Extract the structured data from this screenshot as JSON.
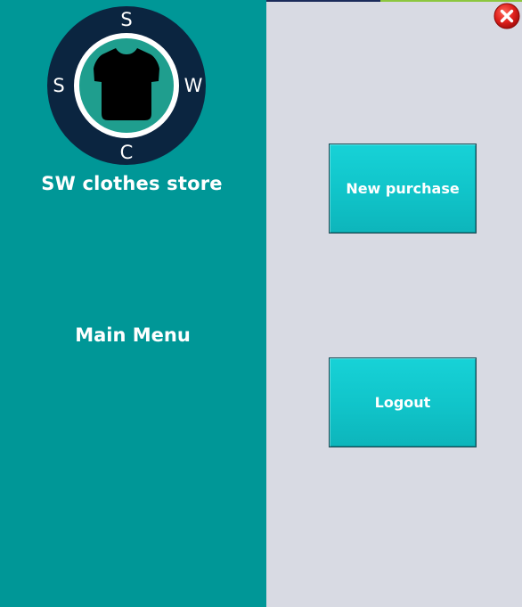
{
  "store": {
    "logo_letters": {
      "top": "S",
      "left": "S",
      "right": "W",
      "bottom": "C"
    },
    "name": "SW clothes store"
  },
  "menu": {
    "title": "Main Menu"
  },
  "buttons": {
    "new_purchase": "New purchase",
    "logout": "Logout"
  },
  "window": {
    "close_icon": "close-icon"
  },
  "colors": {
    "sidebar": "#009797",
    "panel": "#d8dae3",
    "button": "#12c8cd",
    "logo_ring": "#0b2540",
    "logo_inner": "#1f9e8e",
    "close": "#e0201c"
  }
}
